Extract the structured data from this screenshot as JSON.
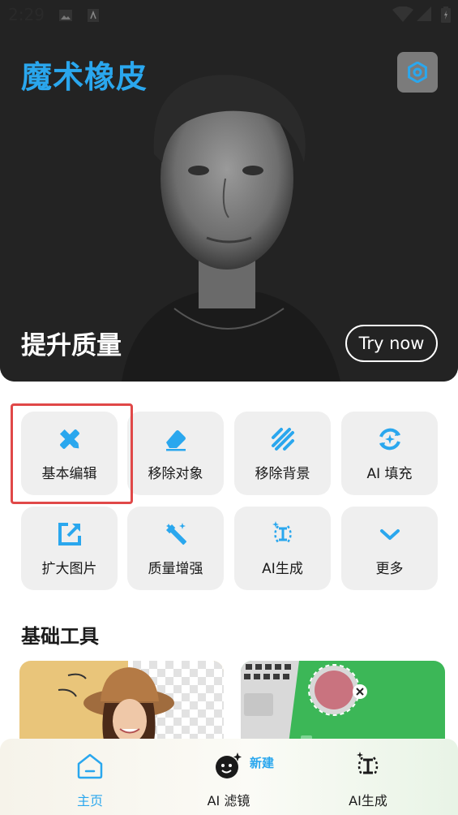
{
  "status": {
    "time": "2:29"
  },
  "app": {
    "title": "魔术橡皮"
  },
  "hero": {
    "caption": "提升质量",
    "cta": "Try now"
  },
  "tools": [
    {
      "label": "基本编辑",
      "icon": "pencil-ruler-icon"
    },
    {
      "label": "移除对象",
      "icon": "eraser-icon"
    },
    {
      "label": "移除背景",
      "icon": "background-remove-icon"
    },
    {
      "label": "AI 填充",
      "icon": "ai-fill-icon"
    },
    {
      "label": "扩大图片",
      "icon": "expand-image-icon"
    },
    {
      "label": "质量增强",
      "icon": "magic-wand-icon"
    },
    {
      "label": "AI生成",
      "icon": "ai-generate-icon"
    },
    {
      "label": "更多",
      "icon": "chevron-down-icon"
    }
  ],
  "section": {
    "title": "基础工具"
  },
  "nav": {
    "items": [
      {
        "label": "主页",
        "icon": "home-icon",
        "active": true
      },
      {
        "label": "AI 滤镜",
        "icon": "face-sparkle-icon",
        "badge": "新建"
      },
      {
        "label": "AI生成",
        "icon": "ai-generate-icon"
      }
    ]
  },
  "colors": {
    "accent": "#2aa7ee",
    "highlight": "#e04848",
    "tile": "#efefef"
  }
}
